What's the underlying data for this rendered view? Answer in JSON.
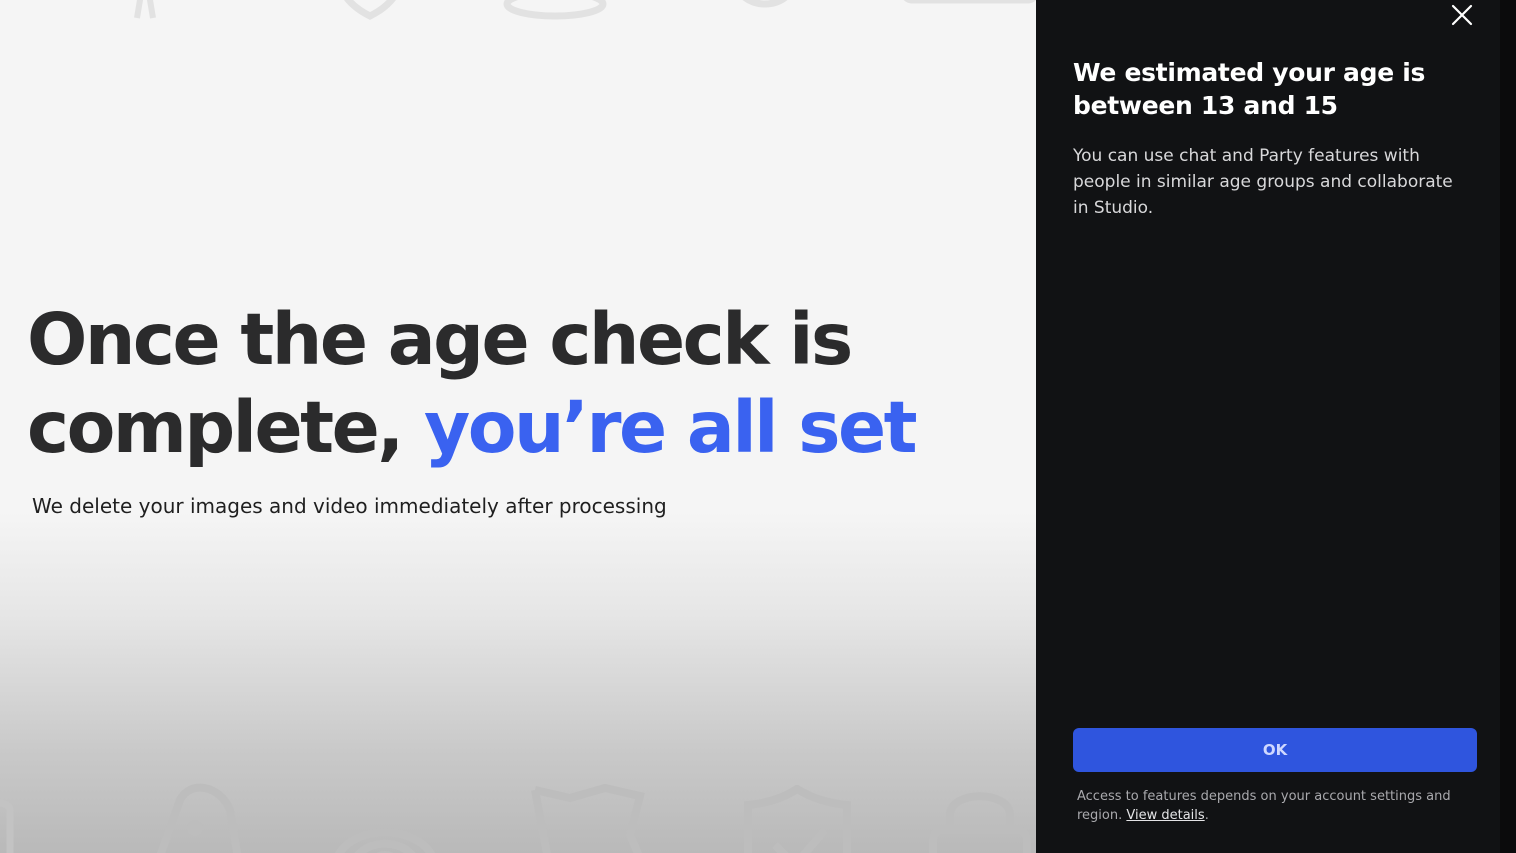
{
  "promo": {
    "headline_line1": "Once the age check is",
    "headline_line2_plain": "complete, ",
    "headline_line2_accent": "you’re all set",
    "subline": "We delete your images and video immediately after processing",
    "accent_color": "#3a62f0",
    "background_icons": [
      "pin-icon",
      "shield-icon",
      "fingerprint-icon",
      "flag-icon",
      "shield-check-icon",
      "lock-icon"
    ]
  },
  "panel": {
    "close_icon": "close-icon",
    "title": "We estimated your age is between 13 and 15",
    "body": "You can use chat and Party features with people in similar age groups and collaborate in Studio.",
    "ok_label": "OK",
    "footnote_text": "Access to features depends on your account settings and region. ",
    "footnote_link": "View details",
    "footnote_end": ".",
    "button_color": "#2f55de"
  }
}
